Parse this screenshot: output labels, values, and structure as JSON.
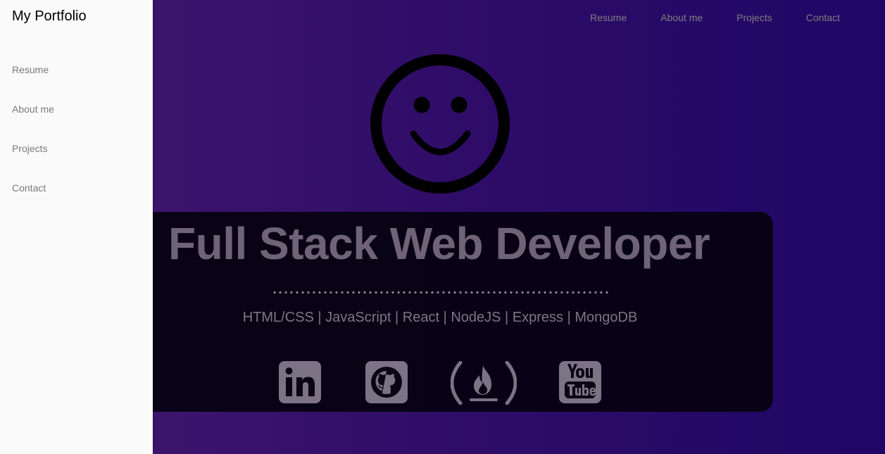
{
  "brand": "My Portfolio",
  "nav": {
    "items": [
      {
        "label": "Resume"
      },
      {
        "label": "About me"
      },
      {
        "label": "Projects"
      },
      {
        "label": "Contact"
      }
    ]
  },
  "sidebar": {
    "items": [
      {
        "label": "Resume"
      },
      {
        "label": "About me"
      },
      {
        "label": "Projects"
      },
      {
        "label": "Contact"
      }
    ]
  },
  "hero": {
    "title": "Full Stack Web Developer",
    "skills": "HTML/CSS | JavaScript | React | NodeJS | Express | MongoDB"
  },
  "social": [
    {
      "icon": "linkedin-icon"
    },
    {
      "icon": "github-icon"
    },
    {
      "icon": "freecodecamp-icon"
    },
    {
      "icon": "youtube-icon"
    }
  ],
  "colors": {
    "background_start": "#44186f",
    "background_end": "#1f0666",
    "sidebar": "#fafafa",
    "card": "#060210",
    "title": "#6f6378",
    "muted": "#7f7f7f"
  }
}
